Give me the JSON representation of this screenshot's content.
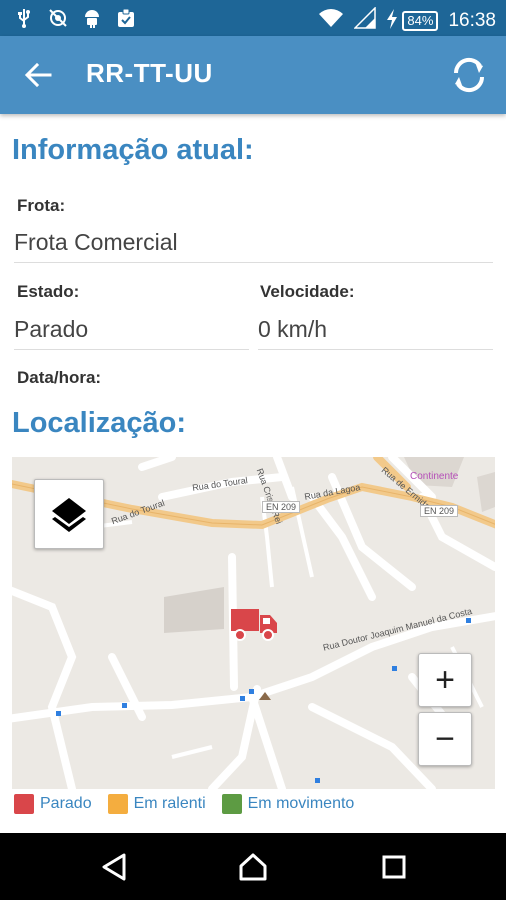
{
  "status_bar": {
    "icons": [
      "usb-icon",
      "no-location-icon",
      "android-icon",
      "clipboard-icon"
    ],
    "battery_percent": "84%",
    "time": "16:38"
  },
  "app_bar": {
    "title": "RR-TT-UU"
  },
  "current_info": {
    "heading": "Informação atual:",
    "fleet_label": "Frota:",
    "fleet_value": "Frota Comercial",
    "state_label": "Estado:",
    "state_value": "Parado",
    "speed_label": "Velocidade:",
    "speed_value": "0 km/h",
    "datetime_label": "Data/hora:"
  },
  "location": {
    "heading": "Localização:",
    "map_labels": {
      "rua_do_toural_1": "Rua do Toural",
      "rua_do_toural_2": "Rua do Toural",
      "rua_da_lagoa": "Rua da Lagoa",
      "en209_1": "EN 209",
      "en209_2": "EN 209",
      "continente": "Continente",
      "rua_cristo_rei": "Rua Cristo Rei",
      "rua_ermida": "Rua de Ermida",
      "rua_joaquim": "Rua Doutor Joaquim Manuel da Costa"
    },
    "zoom_in_label": "+",
    "zoom_out_label": "−"
  },
  "legend": [
    {
      "label": "Parado",
      "color": "#d9464a"
    },
    {
      "label": "Em ralenti",
      "color": "#f4ad3f"
    },
    {
      "label": "Em movimento",
      "color": "#5d9b43"
    }
  ],
  "colors": {
    "primary": "#4a8fc3",
    "status_bar": "#1e6697",
    "heading": "#3a86c0",
    "vehicle": "#d9464a"
  }
}
